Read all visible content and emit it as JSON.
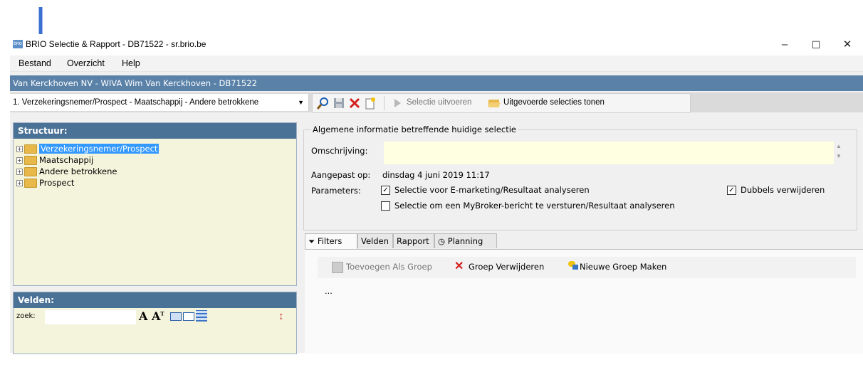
{
  "window": {
    "title": "BRIO Selectie & Rapport - DB71522 - sr.brio.be",
    "app_icon_text": "brio",
    "minimize": "–",
    "maximize": "☐",
    "close": "✕"
  },
  "menu": {
    "file": "Bestand",
    "overview": "Overzicht",
    "help": "Help"
  },
  "info_bar": "Van Kerckhoven NV - WIVA Wim Van Kerckhoven - DB71522",
  "toolbar": {
    "context_select": "1. Verzekeringsnemer/Prospect - Maatschappij - Andere betrokkene",
    "run_selection": "Selectie uitvoeren",
    "show_executed": "Uitgevoerde selecties tonen"
  },
  "structure": {
    "title": "Structuur:",
    "items": [
      "Verzekeringsnemer/Prospect",
      "Maatschappij",
      "Andere betrokkene",
      "Prospect"
    ]
  },
  "fields": {
    "title": "Velden:",
    "search_label": "zoek:",
    "search_value": ""
  },
  "info": {
    "legend": "Algemene informatie betreffende huidige selectie",
    "description_label": "Omschrijving:",
    "description_value": "",
    "modified_label": "Aangepast op:",
    "modified_value": "dinsdag 4 juni 2019 11:17",
    "params_label": "Parameters:",
    "param1": "Selectie voor E-marketing/Resultaat analyseren",
    "param1_checked": true,
    "param2": "Selectie om een MyBroker-bericht te versturen/Resultaat analyseren",
    "param2_checked": false,
    "dedupe": "Dubbels verwijderen",
    "dedupe_checked": true
  },
  "tabs": [
    "Filters",
    "Velden",
    "Rapport",
    "Planning"
  ],
  "filters": {
    "add_group": "Toevoegen Als Groep",
    "remove_group": "Groep Verwijderen",
    "new_group": "Nieuwe Groep Maken",
    "ellipsis": "..."
  },
  "colors": {
    "accent": "#5a82a8",
    "panel_header": "#4a7196",
    "arrow": "#3b6fd0"
  }
}
